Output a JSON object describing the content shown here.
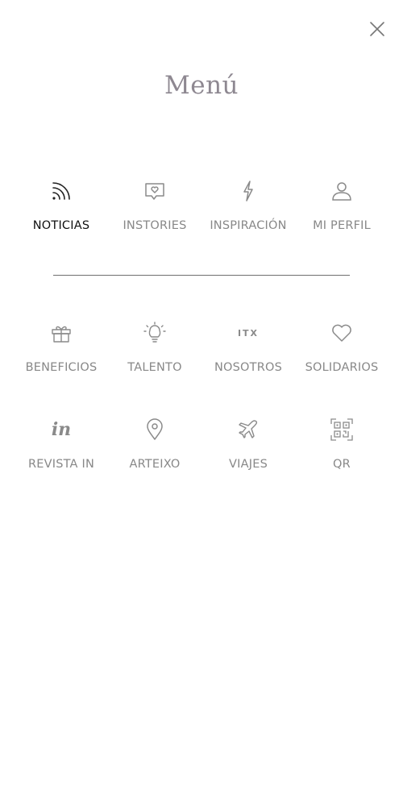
{
  "header": {
    "title": "Menú",
    "close_icon": "close-icon"
  },
  "primary_items": [
    {
      "label": "NOTICIAS",
      "icon": "rss-icon",
      "active": true
    },
    {
      "label": "INSTORIES",
      "icon": "chat-heart-icon",
      "active": false
    },
    {
      "label": "INSPIRACIÓN",
      "icon": "lightning-icon",
      "active": false
    },
    {
      "label": "MI PERFIL",
      "icon": "user-icon",
      "active": false
    }
  ],
  "secondary_items": [
    {
      "label": "BENEFICIOS",
      "icon": "gift-icon"
    },
    {
      "label": "TALENTO",
      "icon": "lightbulb-icon"
    },
    {
      "label": "NOSOTROS",
      "icon": "itx-logo-icon",
      "icon_text": "ITX"
    },
    {
      "label": "SOLIDARIOS",
      "icon": "heart-icon"
    },
    {
      "label": "REVISTA IN",
      "icon": "in-logo-icon",
      "icon_text": "in"
    },
    {
      "label": "ARTEIXO",
      "icon": "location-pin-icon"
    },
    {
      "label": "VIAJES",
      "icon": "airplane-icon"
    },
    {
      "label": "QR",
      "icon": "qr-code-icon"
    }
  ],
  "colors": {
    "active": "#111111",
    "inactive": "#888888",
    "title": "#8e8891",
    "divider": "#6f6f6f"
  }
}
